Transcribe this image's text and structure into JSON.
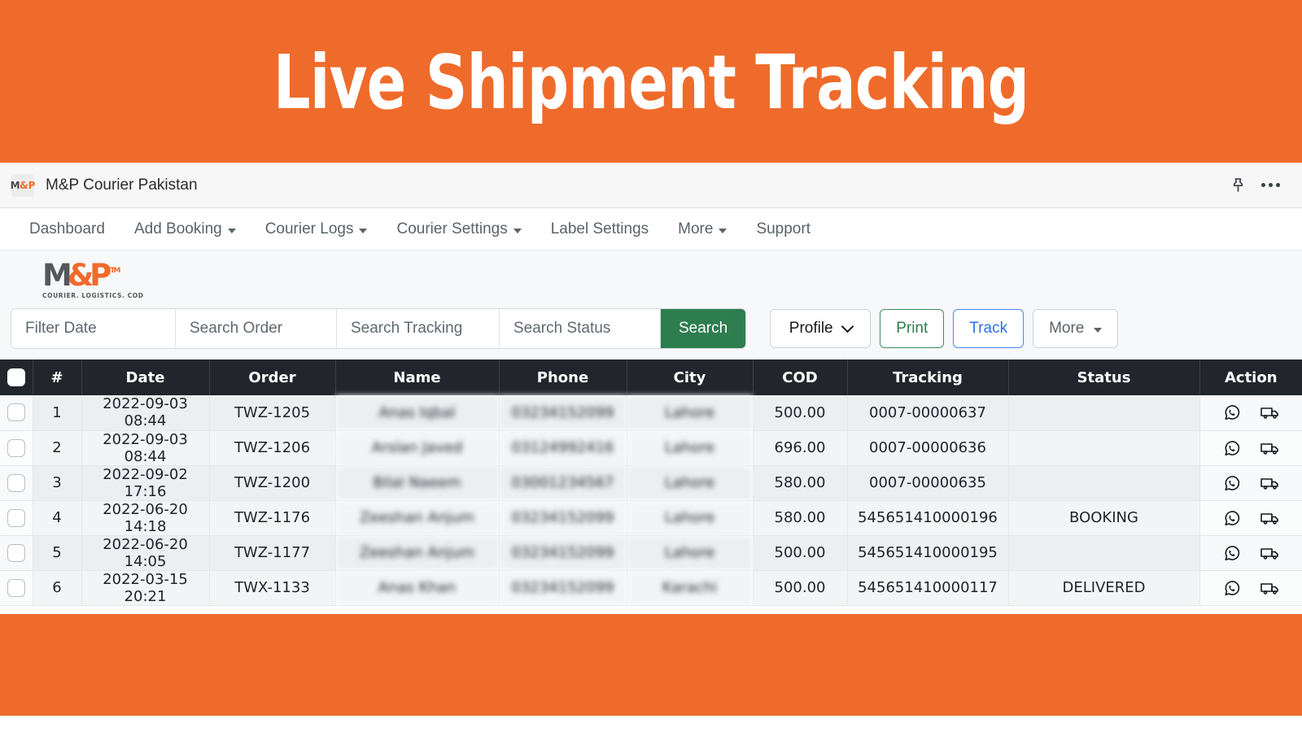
{
  "banner": {
    "title": "Live Shipment Tracking",
    "background_color": "#ef6b2b",
    "text_color": "#ffffff"
  },
  "titlebar": {
    "app_name": "M&P Courier Pakistan",
    "favicon_text": {
      "m": "M",
      "amp": "&",
      "p": "P"
    },
    "icons": [
      {
        "name": "pin-icon",
        "label": "Pin"
      },
      {
        "name": "more-options-icon",
        "label": "More options"
      }
    ]
  },
  "nav": {
    "items": [
      {
        "label": "Dashboard",
        "has_caret": false
      },
      {
        "label": "Add Booking",
        "has_caret": true
      },
      {
        "label": "Courier Logs",
        "has_caret": true
      },
      {
        "label": "Courier Settings",
        "has_caret": true
      },
      {
        "label": "Label Settings",
        "has_caret": false
      },
      {
        "label": "More",
        "has_caret": true
      },
      {
        "label": "Support",
        "has_caret": false
      }
    ]
  },
  "logo": {
    "m": "M",
    "amp": "&",
    "p": "P",
    "tm": "TM",
    "tagline": "COURIER. LOGISTICS. COD",
    "gray": "#54585c",
    "orange": "#ef6b2b"
  },
  "toolbar": {
    "filters": [
      {
        "name": "filter-date",
        "placeholder": "Filter Date",
        "value": ""
      },
      {
        "name": "search-order",
        "placeholder": "Search Order",
        "value": ""
      },
      {
        "name": "search-tracking",
        "placeholder": "Search Tracking",
        "value": ""
      },
      {
        "name": "search-status",
        "placeholder": "Search Status",
        "value": ""
      }
    ],
    "search_label": "Search",
    "search_color": "#2d7d4f",
    "profile_label": "Profile",
    "print_label": "Print",
    "print_color": "#2d7d4f",
    "track_label": "Track",
    "track_color": "#2f6fe4",
    "more_label": "More"
  },
  "table": {
    "columns": [
      "",
      "#",
      "Date",
      "Order",
      "Name",
      "Phone",
      "City",
      "COD",
      "Tracking",
      "Status",
      "Action"
    ],
    "rows": [
      {
        "index": "1",
        "date": "2022-09-03 08:44",
        "order": "TWZ-1205",
        "name": "Anas Iqbal",
        "phone": "03234152099",
        "city": "Lahore",
        "cod": "500.00",
        "tracking": "0007-00000637",
        "status": ""
      },
      {
        "index": "2",
        "date": "2022-09-03 08:44",
        "order": "TWZ-1206",
        "name": "Arslan Javed",
        "phone": "03124992416",
        "city": "Lahore",
        "cod": "696.00",
        "tracking": "0007-00000636",
        "status": ""
      },
      {
        "index": "3",
        "date": "2022-09-02 17:16",
        "order": "TWZ-1200",
        "name": "Bilal Naeem",
        "phone": "03001234567",
        "city": "Lahore",
        "cod": "580.00",
        "tracking": "0007-00000635",
        "status": ""
      },
      {
        "index": "4",
        "date": "2022-06-20 14:18",
        "order": "TWZ-1176",
        "name": "Zeeshan Anjum",
        "phone": "03234152099",
        "city": "Lahore",
        "cod": "580.00",
        "tracking": "545651410000196",
        "status": "BOOKING"
      },
      {
        "index": "5",
        "date": "2022-06-20 14:05",
        "order": "TWZ-1177",
        "name": "Zeeshan Anjum",
        "phone": "03234152099",
        "city": "Lahore",
        "cod": "500.00",
        "tracking": "545651410000195",
        "status": ""
      },
      {
        "index": "6",
        "date": "2022-03-15 20:21",
        "order": "TWX-1133",
        "name": "Anas Khan",
        "phone": "03234152099",
        "city": "Karachi",
        "cod": "500.00",
        "tracking": "545651410000117",
        "status": "DELIVERED"
      }
    ],
    "row_action_icons": [
      {
        "name": "whatsapp-icon",
        "label": "WhatsApp"
      },
      {
        "name": "truck-icon",
        "label": "Track shipment"
      }
    ],
    "header_bg": "#22262c"
  }
}
